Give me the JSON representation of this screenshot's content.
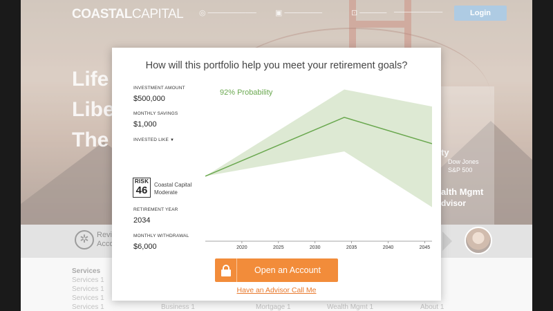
{
  "site": {
    "logo_bold": "COASTAL",
    "logo_light": "CAPITAL",
    "login_label": "Login",
    "hero_lines": [
      "Life",
      "Libe",
      "The"
    ],
    "card": {
      "line1": "ty",
      "line2": "Dow Jones",
      "line3": "S&P 500",
      "line4": "alth Mgmt",
      "line5": "dvisor"
    },
    "strip": {
      "line1": "Revi",
      "line2": "Acco"
    },
    "footer": {
      "col1": [
        "Services",
        "Services 1",
        "Services 1",
        "Services 1",
        "Services 1"
      ],
      "col2": "Business 1",
      "col3": "Mortgage 1",
      "col4": "Wealth Mgmt 1",
      "col5": "About 1"
    }
  },
  "modal": {
    "title": "How will this portfolio help you meet your retirement goals?",
    "fields": {
      "investment_amount_label": "INVESTMENT AMOUNT",
      "investment_amount": "$500,000",
      "monthly_savings_label": "MONTHLY SAVINGS",
      "monthly_savings": "$1,000",
      "invested_like_label": "INVESTED LIKE",
      "risk_label": "RISK",
      "risk_score": "46",
      "risk_name": "Coastal Capital Moderate",
      "retirement_year_label": "RETIREMENT YEAR",
      "retirement_year": "2034",
      "monthly_withdrawal_label": "MONTHLY WITHDRAWAL",
      "monthly_withdrawal": "$6,000"
    },
    "probability_text": "92% Probability",
    "cta_label": "Open an Account",
    "advisor_link": "Have an Advisor Call Me"
  },
  "colors": {
    "accent_green": "#6aa84f",
    "band_green": "#dde9d3",
    "cta_orange": "#f28c3a",
    "link_orange": "#e8772a"
  },
  "icons": {
    "lock": "lock-icon",
    "caret": "caret-down-icon",
    "strip": "compass-icon"
  },
  "chart_data": {
    "type": "area",
    "x_ticks": [
      2020,
      2025,
      2030,
      2035,
      2040,
      2045
    ],
    "xlim": [
      2015,
      2046
    ],
    "x": [
      2015,
      2034,
      2046
    ],
    "median": [
      42,
      80,
      63
    ],
    "upper": [
      42,
      98,
      87
    ],
    "lower": [
      42,
      58,
      22
    ],
    "ylim": [
      0,
      100
    ],
    "grid": false,
    "annotation": "92% Probability"
  }
}
